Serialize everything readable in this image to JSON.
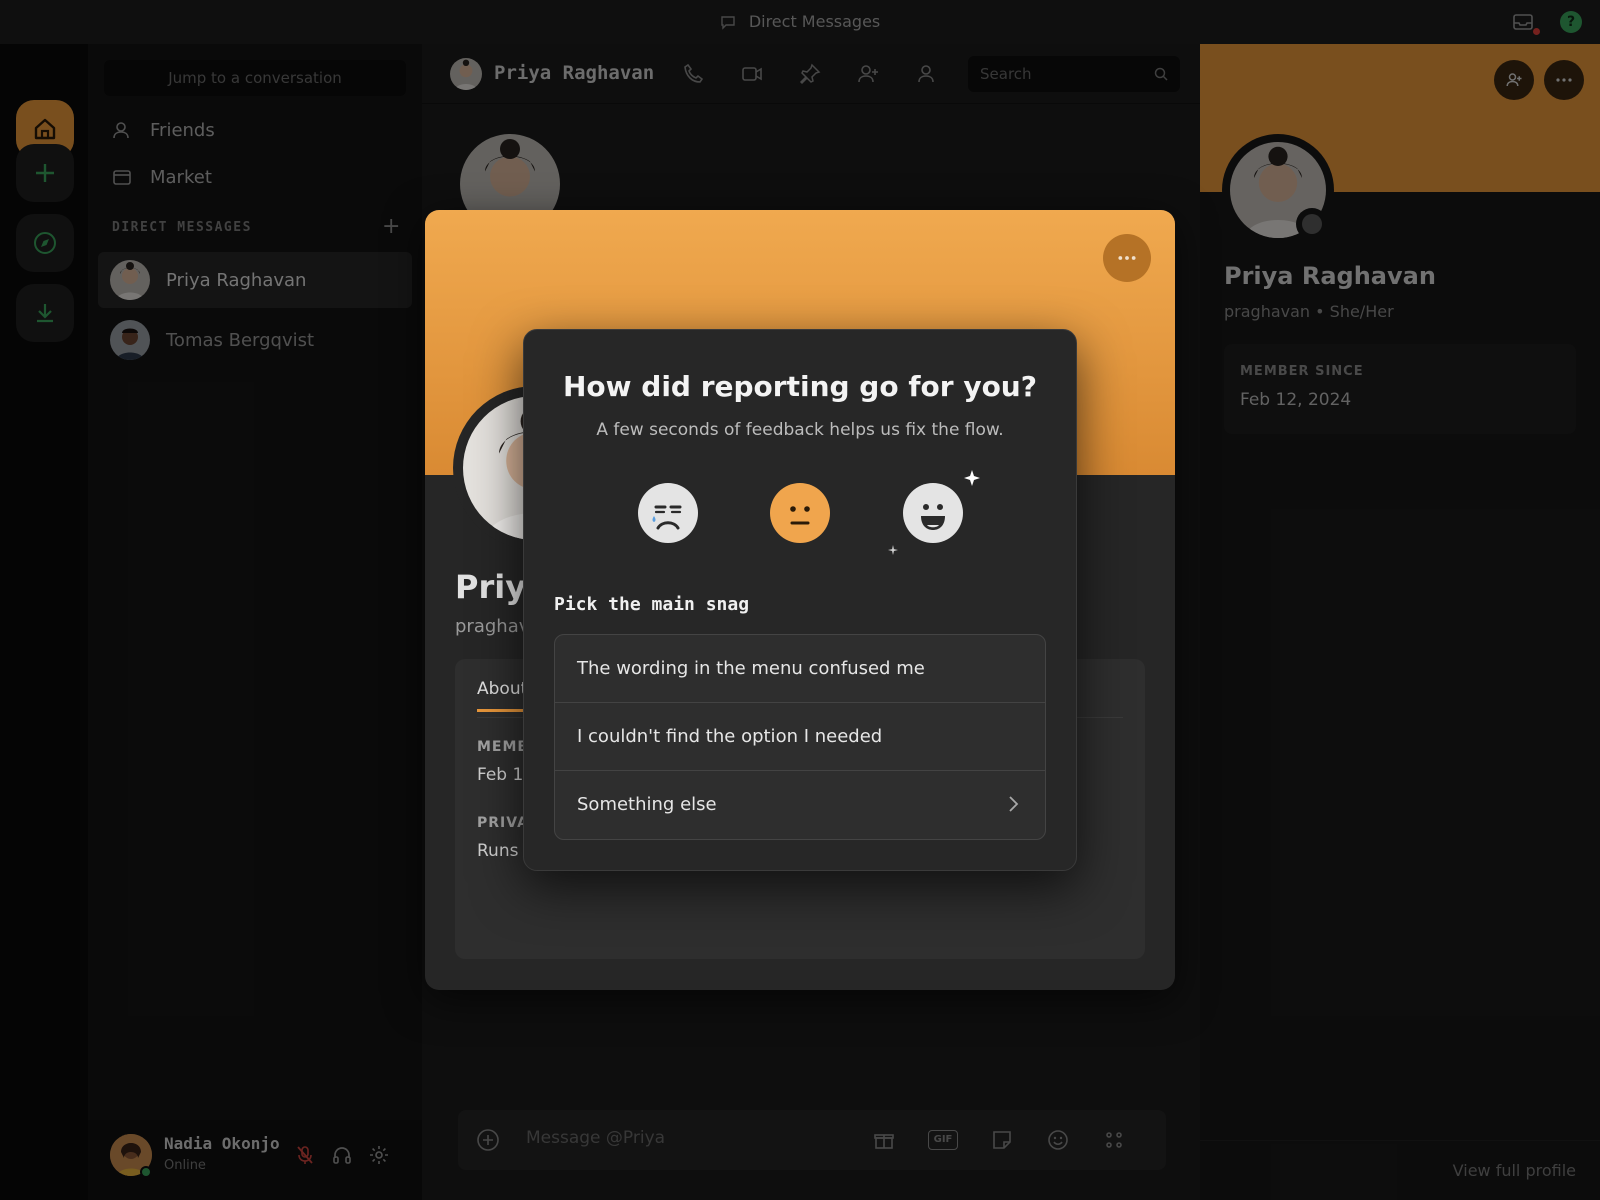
{
  "titlebar": {
    "title": "Direct Messages",
    "icons": [
      "chat-bubble-icon",
      "inbox-icon",
      "help-icon"
    ]
  },
  "channels": {
    "jump_placeholder": "Jump to a conversation",
    "nav": [
      {
        "label": "Friends",
        "icon": "friends-icon"
      },
      {
        "label": "Market",
        "icon": "market-icon"
      }
    ],
    "dm_header": "DIRECT MESSAGES",
    "dms": [
      {
        "name": "Priya Raghavan",
        "active": true
      },
      {
        "name": "Tomas Bergqvist",
        "active": false
      }
    ],
    "user": {
      "name": "Nadia Okonjo",
      "status": "Online"
    }
  },
  "main": {
    "header_name": "Priya Raghavan",
    "search_placeholder": "Search",
    "composer_placeholder": "Message @Priya",
    "gif_label": "GIF"
  },
  "right_panel": {
    "name": "Priya Raghavan",
    "sub": "praghavan • She/Her",
    "member_since_label": "MEMBER SINCE",
    "member_since": "Feb 12, 2024",
    "footer_link": "View full profile"
  },
  "profile_modal": {
    "name": "Priya",
    "sub": "praghav",
    "tab": "About",
    "member_label": "MEMBE",
    "member_value": "Feb 1",
    "private_label": "PRIVA",
    "private_value": "Runs"
  },
  "survey": {
    "title": "How did reporting go for you?",
    "subtitle": "A few seconds of feedback helps us fix the flow.",
    "faces": [
      "sad",
      "neutral",
      "happy"
    ],
    "selected_face": "neutral",
    "question": "Pick the main snag",
    "options": [
      "The wording in the menu confused me",
      "I couldn't find the option I needed",
      "Something else"
    ]
  },
  "colors": {
    "accent": "#e9973b",
    "online": "#3ba55c"
  }
}
